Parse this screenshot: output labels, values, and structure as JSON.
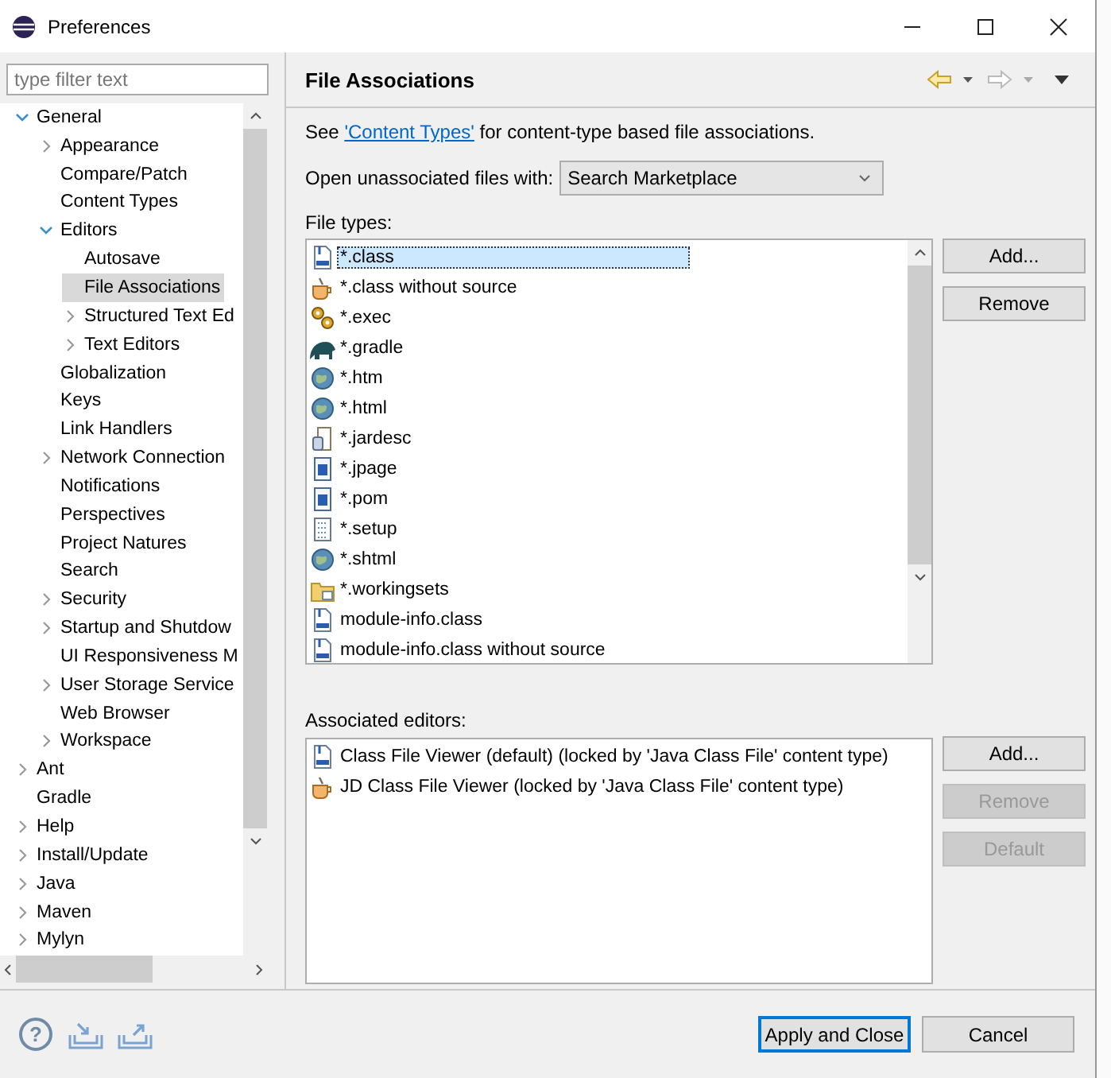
{
  "window": {
    "title": "Preferences"
  },
  "filter": {
    "placeholder": "type filter text"
  },
  "tree": [
    {
      "label": "General",
      "expanded": true,
      "selected": false,
      "children": [
        {
          "label": "Appearance",
          "expanded": false,
          "selected": false
        },
        {
          "label": "Compare/Patch",
          "selected": false
        },
        {
          "label": "Content Types",
          "selected": false
        },
        {
          "label": "Editors",
          "expanded": true,
          "selected": false,
          "children": [
            {
              "label": "Autosave",
              "selected": false
            },
            {
              "label": "File Associations",
              "selected": true
            },
            {
              "label": "Structured Text Ed",
              "expanded": false,
              "selected": false
            },
            {
              "label": "Text Editors",
              "expanded": false,
              "selected": false
            }
          ]
        },
        {
          "label": "Globalization",
          "selected": false
        },
        {
          "label": "Keys",
          "selected": false
        },
        {
          "label": "Link Handlers",
          "selected": false
        },
        {
          "label": "Network Connection",
          "expanded": false,
          "selected": false
        },
        {
          "label": "Notifications",
          "selected": false
        },
        {
          "label": "Perspectives",
          "selected": false
        },
        {
          "label": "Project Natures",
          "selected": false
        },
        {
          "label": "Search",
          "selected": false
        },
        {
          "label": "Security",
          "expanded": false,
          "selected": false
        },
        {
          "label": "Startup and Shutdow",
          "expanded": false,
          "selected": false
        },
        {
          "label": "UI Responsiveness M",
          "selected": false
        },
        {
          "label": "User Storage Service",
          "expanded": false,
          "selected": false
        },
        {
          "label": "Web Browser",
          "selected": false
        },
        {
          "label": "Workspace",
          "expanded": false,
          "selected": false
        }
      ]
    },
    {
      "label": "Ant",
      "expanded": false,
      "selected": false
    },
    {
      "label": "Gradle",
      "selected": false
    },
    {
      "label": "Help",
      "expanded": false,
      "selected": false
    },
    {
      "label": "Install/Update",
      "expanded": false,
      "selected": false
    },
    {
      "label": "Java",
      "expanded": false,
      "selected": false
    },
    {
      "label": "Maven",
      "expanded": false,
      "selected": false
    },
    {
      "label": "Mylyn",
      "expanded": false,
      "selected": false
    }
  ],
  "page": {
    "title": "File Associations",
    "intro_before": "See ",
    "intro_link": "'Content Types'",
    "intro_after": " for content-type based file associations.",
    "open_with": {
      "label": "Open unassociated files with:",
      "value": "Search Marketplace"
    },
    "file_types": {
      "label": "File types:",
      "items": [
        {
          "name": "*.class",
          "kind": "class",
          "selected": true
        },
        {
          "name": "*.class without source",
          "kind": "cup",
          "selected": false
        },
        {
          "name": "*.exec",
          "kind": "gears",
          "selected": false
        },
        {
          "name": "*.gradle",
          "kind": "elephant",
          "selected": false
        },
        {
          "name": "*.htm",
          "kind": "globe",
          "selected": false
        },
        {
          "name": "*.html",
          "kind": "globe",
          "selected": false
        },
        {
          "name": "*.jardesc",
          "kind": "jar",
          "selected": false
        },
        {
          "name": "*.jpage",
          "kind": "page",
          "selected": false
        },
        {
          "name": "*.pom",
          "kind": "page",
          "selected": false
        },
        {
          "name": "*.setup",
          "kind": "pattern",
          "selected": false
        },
        {
          "name": "*.shtml",
          "kind": "globe",
          "selected": false
        },
        {
          "name": "*.workingsets",
          "kind": "folder",
          "selected": false
        },
        {
          "name": "module-info.class",
          "kind": "class",
          "selected": false
        },
        {
          "name": "module-info.class without source",
          "kind": "class",
          "selected": false
        }
      ]
    },
    "file_type_buttons": [
      {
        "label": "Add...",
        "disabled": false
      },
      {
        "label": "Remove",
        "disabled": false
      }
    ],
    "associated_editors": {
      "label": "Associated editors:",
      "items": [
        {
          "name": "Class File Viewer (default) (locked by 'Java Class File' content type)",
          "kind": "class",
          "selected": false
        },
        {
          "name": "JD Class File Viewer (locked by 'Java Class File' content type)",
          "kind": "cup",
          "selected": false
        }
      ]
    },
    "editor_buttons": [
      {
        "label": "Add...",
        "disabled": false
      },
      {
        "label": "Remove",
        "disabled": true
      },
      {
        "label": "Default",
        "disabled": true
      }
    ]
  },
  "footer": {
    "help": "?",
    "buttons": [
      {
        "label": "Apply and Close",
        "default": true
      },
      {
        "label": "Cancel",
        "default": false
      }
    ]
  }
}
